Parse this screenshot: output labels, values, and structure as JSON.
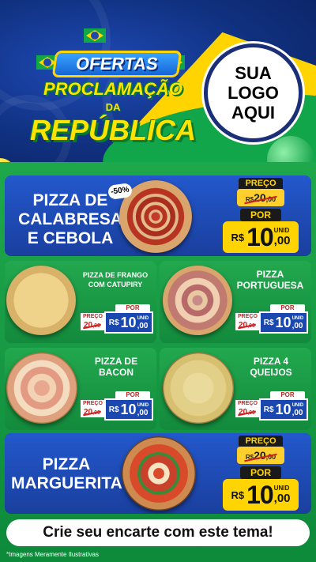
{
  "header": {
    "title_top": "OFERTAS",
    "title_mid": "PROCLAMAÇÃO",
    "title_da": "DA",
    "title_bottom": "REPÚBLICA",
    "logo_lines": [
      "SUA",
      "LOGO",
      "AQUI"
    ]
  },
  "featured": [
    {
      "name_lines": [
        "PIZZA DE",
        "CALABRESA",
        "E CEBOLA"
      ],
      "discount_badge": "-50%",
      "preco_label": "PREÇO",
      "old_currency": "R$",
      "old_int": "20",
      "old_dec": ",00",
      "por_label": "POR",
      "currency": "R$",
      "price_int": "10",
      "price_dec": ",00",
      "unit": "UNID"
    },
    {
      "name_lines": [
        "PIZZA",
        "MARGUERITA"
      ],
      "preco_label": "PREÇO",
      "old_currency": "R$",
      "old_int": "20",
      "old_dec": ",00",
      "por_label": "POR",
      "currency": "R$",
      "price_int": "10",
      "price_dec": ",00",
      "unit": "UNID"
    }
  ],
  "products": [
    {
      "name_lines": [
        "PIZZA DE FRANGO",
        "COM CATUPIRY"
      ],
      "por_label": "POR",
      "preco_label": "PREÇO",
      "old_int": "20",
      "old_dec": ",00",
      "currency": "R$",
      "price_int": "10",
      "price_dec": ",00",
      "unit": "UNID"
    },
    {
      "name_lines": [
        "PIZZA",
        "PORTUGUESA"
      ],
      "por_label": "POR",
      "preco_label": "PREÇO",
      "old_int": "20",
      "old_dec": ",00",
      "currency": "R$",
      "price_int": "10",
      "price_dec": ",00",
      "unit": "UNID"
    },
    {
      "name_lines": [
        "PIZZA DE",
        "BACON"
      ],
      "por_label": "POR",
      "preco_label": "PREÇO",
      "old_int": "20",
      "old_dec": ",00",
      "currency": "R$",
      "price_int": "10",
      "price_dec": ",00",
      "unit": "UNID"
    },
    {
      "name_lines": [
        "PIZZA 4",
        "QUEIJOS"
      ],
      "por_label": "POR",
      "preco_label": "PREÇO",
      "old_int": "20",
      "old_dec": ",00",
      "currency": "R$",
      "price_int": "10",
      "price_dec": ",00",
      "unit": "UNID"
    }
  ],
  "footer": {
    "cta": "Crie seu encarte com este tema!",
    "disclaimer": "*Imagens Meramente Ilustrativas"
  },
  "colors": {
    "blue": "#1a47b0",
    "green": "#12a64a",
    "yellow": "#ffd400",
    "strike_red": "#d21e1e"
  }
}
